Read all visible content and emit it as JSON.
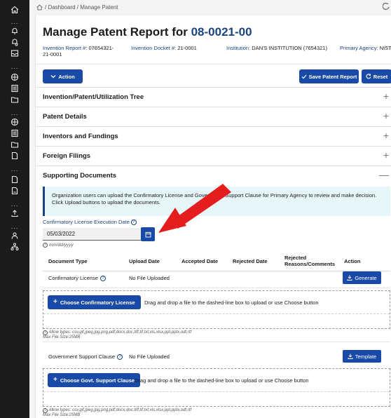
{
  "breadcrumb": {
    "path": "/ Dashboard / Manage Patent"
  },
  "page": {
    "title_prefix": "Manage Patent Report for",
    "title_id": "08-0021-00"
  },
  "info": {
    "report_label": "Invention Report #:",
    "report_value": "07654321-21-0001",
    "docket_label": "Invention Docket #:",
    "docket_value": "21-0001",
    "institution_label": "Institution:",
    "institution_value": "DAN'S INSTITUTION (7654321)",
    "agency_label": "Primary Agency:",
    "agency_value": "NIST"
  },
  "toolbar": {
    "action": "Action",
    "save": "Save Patent Report",
    "reset": "Reset"
  },
  "sections": [
    {
      "label": "Invention/Patent/Utilization Tree",
      "sign": "+"
    },
    {
      "label": "Patent Details",
      "sign": "+"
    },
    {
      "label": "Inventors and Fundings",
      "sign": "+"
    },
    {
      "label": "Foreign Filings",
      "sign": "+"
    },
    {
      "label": "Supporting Documents",
      "sign": "—"
    }
  ],
  "alert": {
    "text": "Organization users can upload the Confirmatory License and Government Support Clause for Primary Agency to review and make decision. Click Upload buttons to upload the documents."
  },
  "date": {
    "label": "Confirmatory License Execution Date",
    "value": "05/03/2022",
    "hint": "mm/dd/yyyy"
  },
  "table": {
    "headers": [
      "Document Type",
      "Upload Date",
      "Accepted Date",
      "Rejected Date",
      "Rejected Reasons/Comments",
      "Action"
    ],
    "rows": [
      {
        "type": "Confirmatory License",
        "upload": "No File Uploaded",
        "action": "Generate",
        "choose": "Choose Confirmatory License",
        "drop": "Drag and drop a file to the dashed-line box to upload or use Choose button"
      },
      {
        "type": "Government Support Clause",
        "upload": "No File Uploaded",
        "action": "Template",
        "choose": "Choose Govt. Support Clause",
        "drop": "Drag and drop a file to the dashed-line box to upload or use Choose button"
      }
    ],
    "allow_types": "Allow types: csv,gif,jpeg,jpg,png,pdf,docx,doc,tiff,tif,txt,xls,xlsx,ppt,pptx,odt,rtf",
    "max_size": "Max File Size:25MB"
  },
  "colors": {
    "primary": "#1a4aa8",
    "link": "#1a4480",
    "rail": "#1b1b1b",
    "alert_bg": "#e7f6f8"
  }
}
